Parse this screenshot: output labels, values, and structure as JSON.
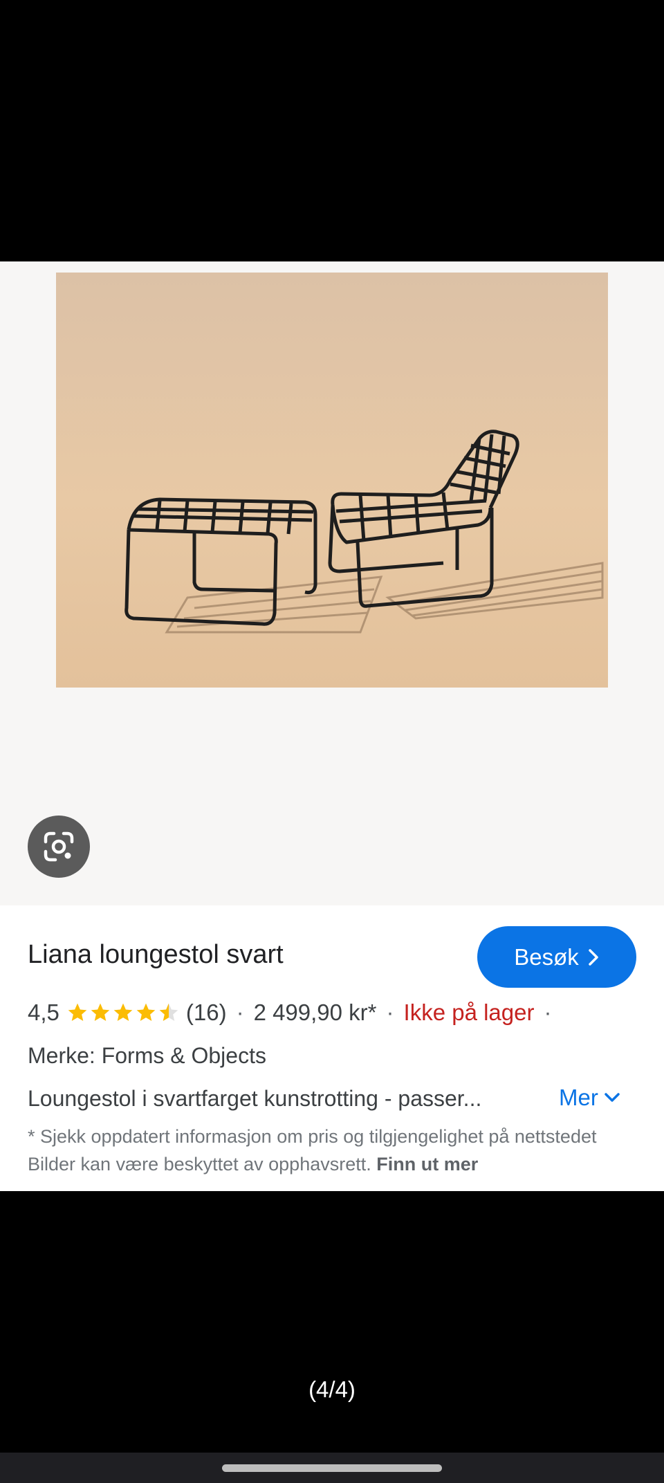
{
  "image": {
    "alt": "Liana loungestol svart",
    "background_color": "#e6c7a3"
  },
  "lens_button": {
    "icon": "google-lens-icon"
  },
  "product": {
    "title": "Liana loungestol svart",
    "visit_label": "Besøk",
    "visit_icon": "chevron-right-icon",
    "rating_value": "4,5",
    "rating_stars": 4.5,
    "reviews": "(16)",
    "separator": "·",
    "price": "2 499,90 kr*",
    "stock": "Ikke på lager",
    "brand": "Merke: Forms & Objects",
    "description": "Loungestol i svartfarget kunstrotting - passer...",
    "more_label": "Mer",
    "more_icon": "chevron-down-icon",
    "disclaimer": "* Sjekk oppdatert informasjon om pris og tilgjengelighet på nettstedet Bilder kan være beskyttet av opphavsrett.",
    "learn_more": "Finn ut mer"
  },
  "colors": {
    "accent": "#0b74e5",
    "stock_red": "#c5221f",
    "star": "#fbbc04"
  },
  "pager": {
    "counter": "(4/4)"
  }
}
